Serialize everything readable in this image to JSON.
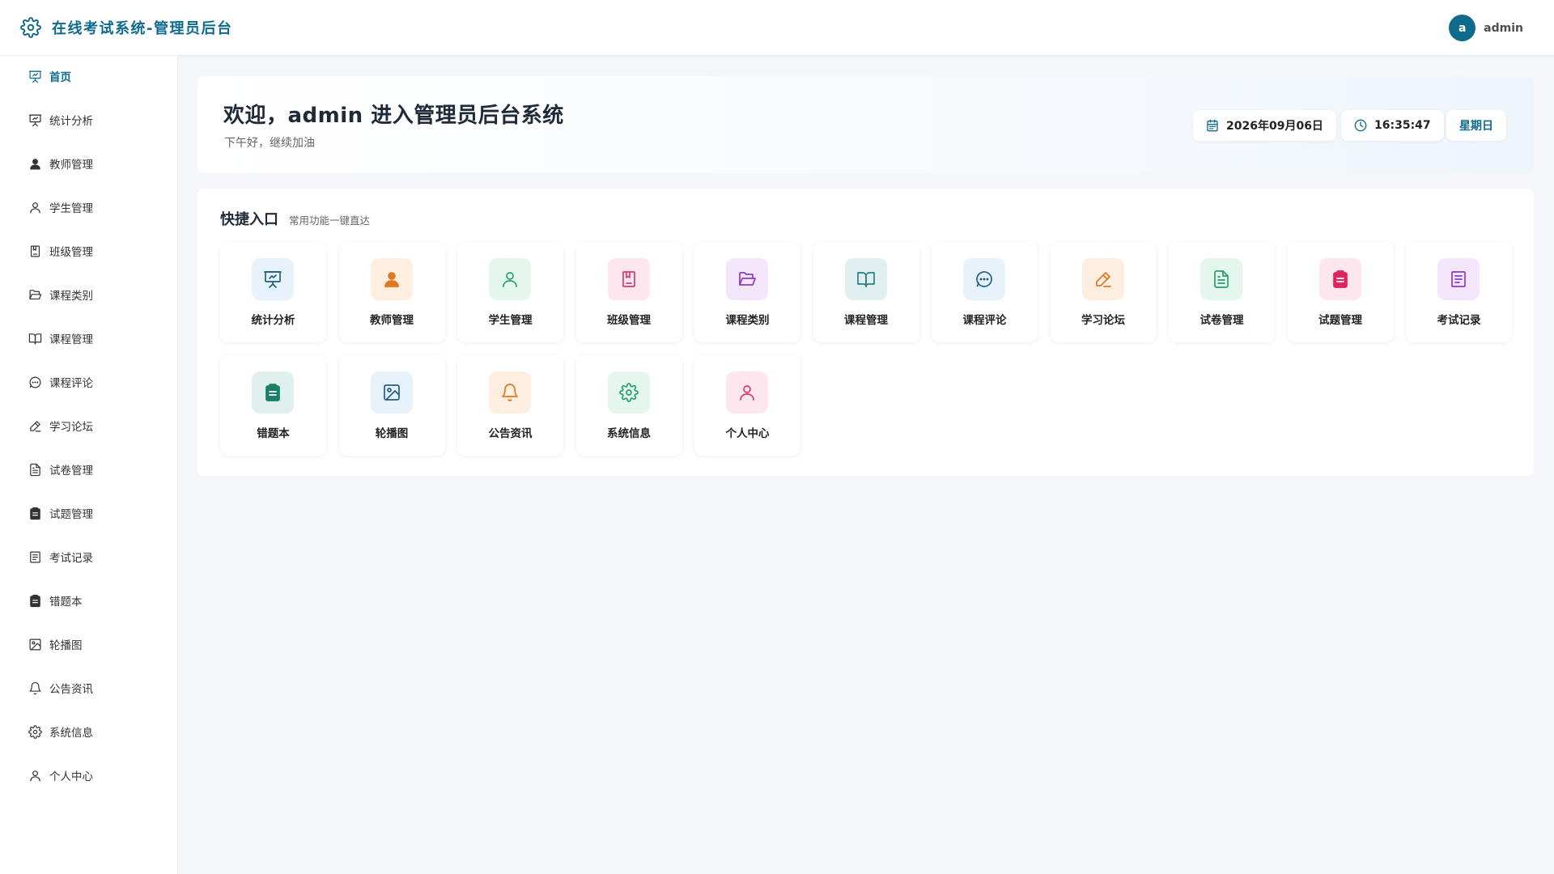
{
  "app": {
    "title": "在线考试系统-管理员后台"
  },
  "user": {
    "avatar_letter": "a",
    "name": "admin"
  },
  "sidebar": {
    "items": [
      {
        "label": "首页",
        "icon": "presentation-icon",
        "active": true
      },
      {
        "label": "统计分析",
        "icon": "presentation-icon"
      },
      {
        "label": "教师管理",
        "icon": "user-filled-icon"
      },
      {
        "label": "学生管理",
        "icon": "user-icon"
      },
      {
        "label": "班级管理",
        "icon": "notebook-icon"
      },
      {
        "label": "课程类别",
        "icon": "folder-open-icon"
      },
      {
        "label": "课程管理",
        "icon": "book-open-icon"
      },
      {
        "label": "课程评论",
        "icon": "chat-icon"
      },
      {
        "label": "学习论坛",
        "icon": "edit-pen-icon"
      },
      {
        "label": "试卷管理",
        "icon": "document-icon"
      },
      {
        "label": "试题管理",
        "icon": "clipboard-filled-icon"
      },
      {
        "label": "考试记录",
        "icon": "tickets-icon"
      },
      {
        "label": "错题本",
        "icon": "clipboard-filled-icon"
      },
      {
        "label": "轮播图",
        "icon": "picture-icon"
      },
      {
        "label": "公告资讯",
        "icon": "bell-icon"
      },
      {
        "label": "系统信息",
        "icon": "gear-icon"
      },
      {
        "label": "个人中心",
        "icon": "user-icon"
      }
    ]
  },
  "welcome": {
    "title": "欢迎，admin 进入管理员后台系统",
    "subtitle": "下午好，继续加油",
    "date": "2026年09月06日",
    "time": "16:35:47",
    "weekday": "星期日"
  },
  "quick": {
    "title": "快捷入口",
    "subtitle": "常用功能一键直达",
    "tiles": [
      {
        "label": "统计分析",
        "icon": "presentation-icon",
        "color": "#1f5f8b",
        "bg": "#e8f2fb"
      },
      {
        "label": "教师管理",
        "icon": "user-filled-icon",
        "color": "#e07a1f",
        "bg": "#fdeee0"
      },
      {
        "label": "学生管理",
        "icon": "user-icon",
        "color": "#27a06a",
        "bg": "#e4f6ee"
      },
      {
        "label": "班级管理",
        "icon": "notebook-icon",
        "color": "#d63a6f",
        "bg": "#fde6ee"
      },
      {
        "label": "课程类别",
        "icon": "folder-open-icon",
        "color": "#8e3bc0",
        "bg": "#f3e6fa"
      },
      {
        "label": "课程管理",
        "icon": "book-open-icon",
        "color": "#2b7e84",
        "bg": "#e0f0f0"
      },
      {
        "label": "课程评论",
        "icon": "chat-icon",
        "color": "#1f5f8b",
        "bg": "#e8f2fb"
      },
      {
        "label": "学习论坛",
        "icon": "edit-pen-icon",
        "color": "#e07a1f",
        "bg": "#fdeee0"
      },
      {
        "label": "试卷管理",
        "icon": "document-icon",
        "color": "#27a06a",
        "bg": "#e4f6ee"
      },
      {
        "label": "试题管理",
        "icon": "clipboard-filled-icon",
        "color": "#e0245e",
        "bg": "#fde6ee"
      },
      {
        "label": "考试记录",
        "icon": "tickets-icon",
        "color": "#8e3bc0",
        "bg": "#f3e6fa"
      },
      {
        "label": "错题本",
        "icon": "clipboard-filled-icon",
        "color": "#1a7f6a",
        "bg": "#e0f0ee"
      },
      {
        "label": "轮播图",
        "icon": "picture-icon",
        "color": "#1f5f8b",
        "bg": "#e8f2fb"
      },
      {
        "label": "公告资讯",
        "icon": "bell-icon",
        "color": "#e07a1f",
        "bg": "#fdeee0"
      },
      {
        "label": "系统信息",
        "icon": "gear-icon",
        "color": "#27a06a",
        "bg": "#e4f6ee"
      },
      {
        "label": "个人中心",
        "icon": "user-icon",
        "color": "#d63a6f",
        "bg": "#fde6ee"
      }
    ]
  },
  "colors": {
    "brand": "#0e6b8c",
    "sidebar_icon": "#333333"
  }
}
